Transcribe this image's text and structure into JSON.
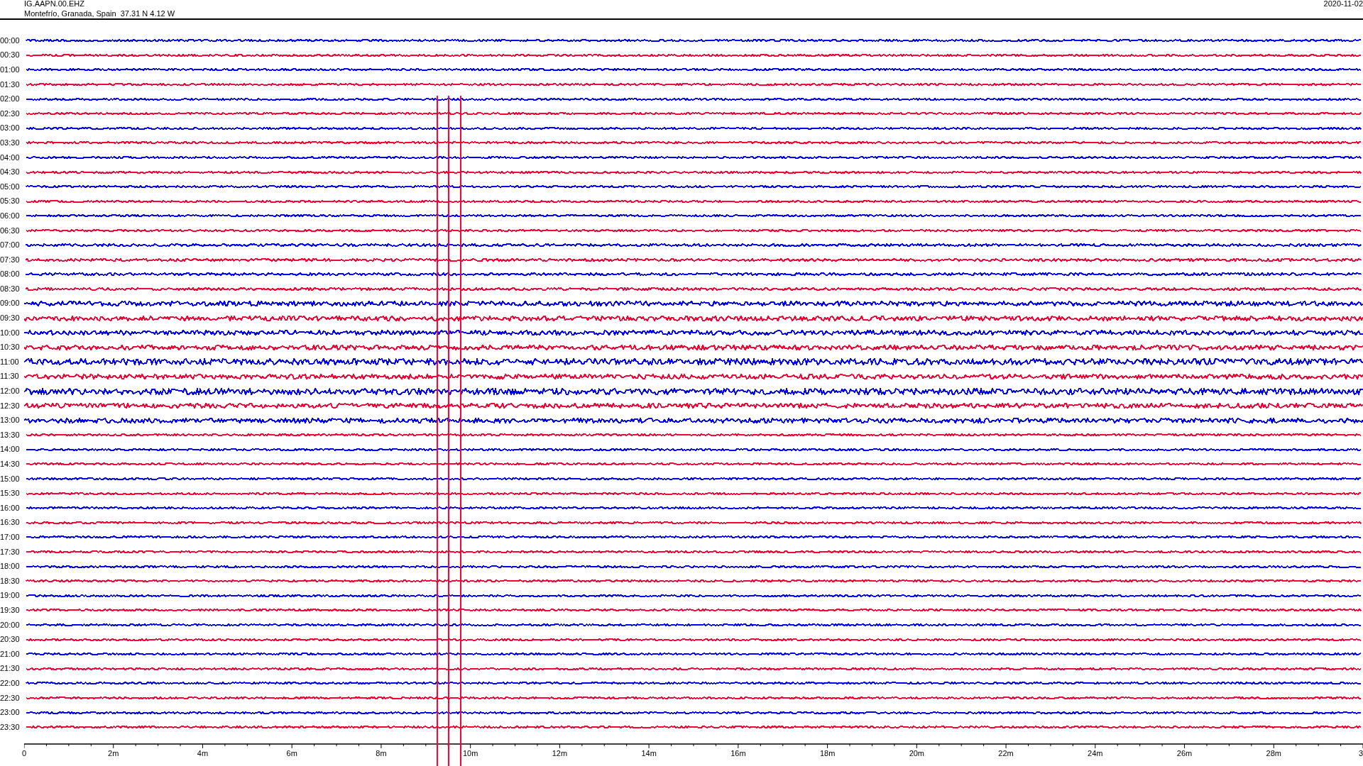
{
  "header": {
    "station": "IG.AAPN.00.EHZ",
    "location": "Montefrío, Granada, Spain  37.31 N 4.12 W",
    "date": "2020-11-02"
  },
  "rows": [
    {
      "label": "00:00",
      "color": "#0000ff"
    },
    {
      "label": "00:30",
      "color": "#ff0033"
    },
    {
      "label": "01:00",
      "color": "#0000ff"
    },
    {
      "label": "01:30",
      "color": "#ff0033"
    },
    {
      "label": "02:00",
      "color": "#0000ff"
    },
    {
      "label": "02:30",
      "color": "#ff0033"
    },
    {
      "label": "03:00",
      "color": "#0000ff"
    },
    {
      "label": "03:30",
      "color": "#ff0033"
    },
    {
      "label": "04:00",
      "color": "#0000ff"
    },
    {
      "label": "04:30",
      "color": "#ff0033"
    },
    {
      "label": "05:00",
      "color": "#0000ff"
    },
    {
      "label": "05:30",
      "color": "#ff0033"
    },
    {
      "label": "06:00",
      "color": "#0000ff"
    },
    {
      "label": "06:30",
      "color": "#ff0033"
    },
    {
      "label": "07:00",
      "color": "#0000ff"
    },
    {
      "label": "07:30",
      "color": "#ff0033"
    },
    {
      "label": "08:00",
      "color": "#0000ff"
    },
    {
      "label": "08:30",
      "color": "#ff0033"
    },
    {
      "label": "09:00",
      "color": "#0000ff"
    },
    {
      "label": "09:30",
      "color": "#ff0033"
    },
    {
      "label": "10:00",
      "color": "#0000ff"
    },
    {
      "label": "10:30",
      "color": "#ff0033"
    },
    {
      "label": "11:00",
      "color": "#0000ff"
    },
    {
      "label": "11:30",
      "color": "#ff0033"
    },
    {
      "label": "12:00",
      "color": "#0000ff"
    },
    {
      "label": "12:30",
      "color": "#ff0033"
    },
    {
      "label": "13:00",
      "color": "#0000ff"
    },
    {
      "label": "13:30",
      "color": "#ff0033"
    },
    {
      "label": "14:00",
      "color": "#0000ff"
    },
    {
      "label": "14:30",
      "color": "#ff0033"
    },
    {
      "label": "15:00",
      "color": "#0000ff"
    },
    {
      "label": "15:30",
      "color": "#ff0033"
    },
    {
      "label": "16:00",
      "color": "#0000ff"
    },
    {
      "label": "16:30",
      "color": "#ff0033"
    },
    {
      "label": "17:00",
      "color": "#0000ff"
    },
    {
      "label": "17:30",
      "color": "#ff0033"
    },
    {
      "label": "18:00",
      "color": "#0000ff"
    },
    {
      "label": "18:30",
      "color": "#ff0033"
    },
    {
      "label": "19:00",
      "color": "#0000ff"
    },
    {
      "label": "19:30",
      "color": "#ff0033"
    },
    {
      "label": "20:00",
      "color": "#0000ff"
    },
    {
      "label": "20:30",
      "color": "#ff0033"
    },
    {
      "label": "21:00",
      "color": "#0000ff"
    },
    {
      "label": "21:30",
      "color": "#ff0033"
    },
    {
      "label": "22:00",
      "color": "#0000ff"
    },
    {
      "label": "22:30",
      "color": "#ff0033"
    },
    {
      "label": "23:00",
      "color": "#0000ff"
    },
    {
      "label": "23:30",
      "color": "#ff0033"
    }
  ],
  "x_axis": {
    "ticks": [
      "0",
      "2m",
      "4m",
      "6m",
      "8m",
      "10m",
      "12m",
      "14m",
      "16m",
      "18m",
      "20m",
      "22m",
      "24m",
      "26m",
      "28m",
      "3"
    ]
  }
}
